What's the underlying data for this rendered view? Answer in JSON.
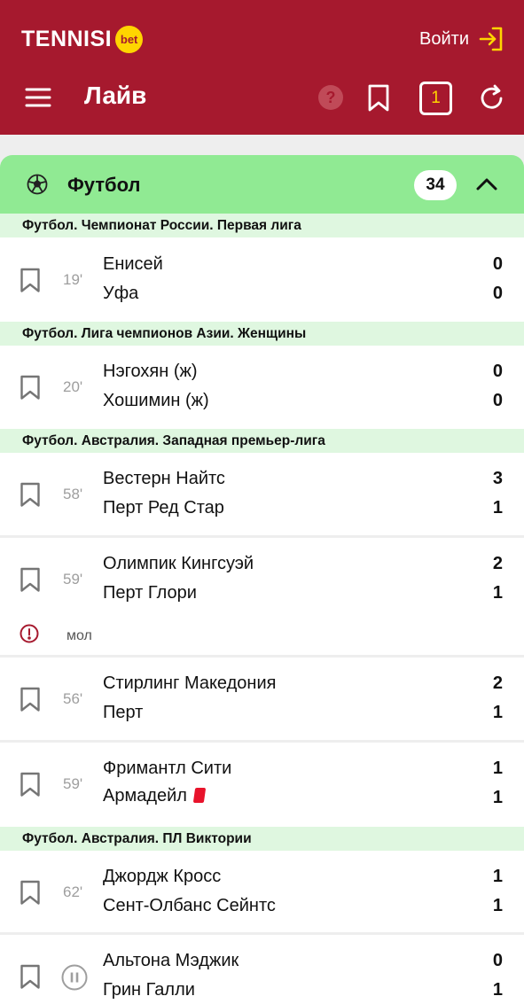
{
  "header": {
    "brand": "TENNISI",
    "brand_badge": "bet",
    "login_label": "Войти",
    "page_title": "Лайв",
    "coupon_count": "1",
    "icons": [
      "menu-icon",
      "help-icon",
      "bookmark-icon",
      "coupon-icon",
      "refresh-icon",
      "login-icon"
    ]
  },
  "sport": {
    "name": "Футбол",
    "count": "34",
    "icon": "soccer-ball-icon"
  },
  "leagues": [
    {
      "name": "Футбол. Чемпионат России. Первая лига"
    },
    {
      "name": "Футбол. Лига чемпионов Азии. Женщины"
    },
    {
      "name": "Футбол. Австралия. Западная премьер-лига"
    },
    {
      "name": "Футбол. Австралия. ПЛ Виктории"
    }
  ],
  "matches": [
    {
      "time": "19'",
      "home": "Енисей",
      "away": "Уфа",
      "home_score": "0",
      "away_score": "0"
    },
    {
      "time": "20'",
      "home": "Нэгохян (ж)",
      "away": "Хошимин (ж)",
      "home_score": "0",
      "away_score": "0"
    },
    {
      "time": "58'",
      "home": "Вестерн Найтс",
      "away": "Перт Ред Стар",
      "home_score": "3",
      "away_score": "1"
    },
    {
      "time": "59'",
      "home": "Олимпик Кингсуэй",
      "away": "Перт Глори",
      "home_score": "2",
      "away_score": "1",
      "note": "мол"
    },
    {
      "time": "56'",
      "home": "Стирлинг Македония",
      "away": "Перт",
      "home_score": "2",
      "away_score": "1"
    },
    {
      "time": "59'",
      "home": "Фримантл Сити",
      "away": "Армадейл",
      "home_score": "1",
      "away_score": "1",
      "away_red_card": true
    },
    {
      "time": "62'",
      "home": "Джордж Кросс",
      "away": "Сент-Олбанс Сейнтс",
      "home_score": "1",
      "away_score": "1"
    },
    {
      "time": "",
      "status_icon": "pause-icon",
      "home": "Альтона Мэджик",
      "away": "Грин Галли",
      "home_score": "0",
      "away_score": "1"
    }
  ],
  "colors": {
    "header_bg": "#a6192e",
    "brand_yellow": "#ffd500",
    "sport_header_bg": "#90ea93",
    "league_bg": "#dff7e0",
    "red_card": "#e8132b",
    "alert_red": "#a6192e"
  }
}
